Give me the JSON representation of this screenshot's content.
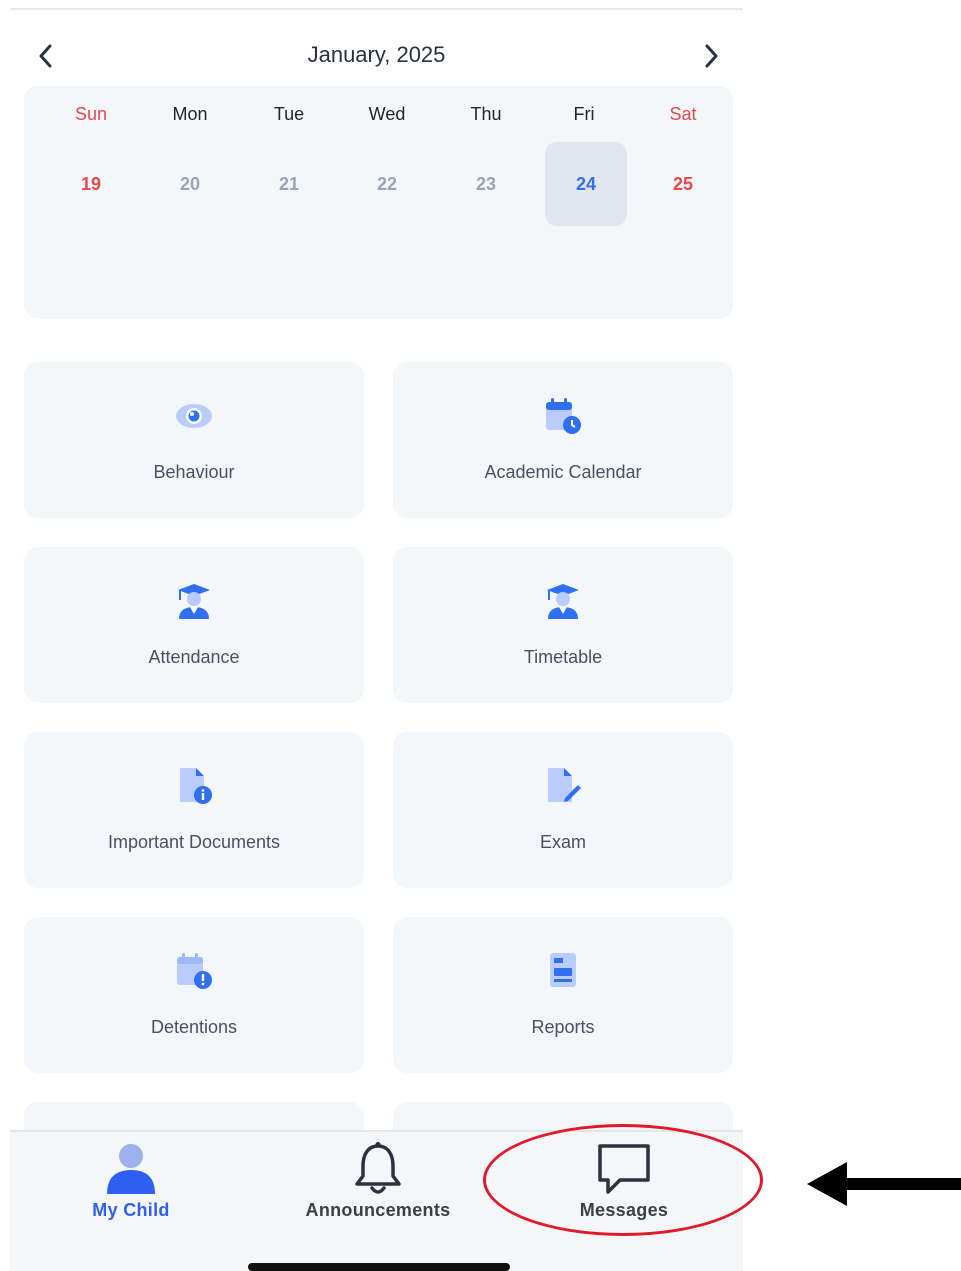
{
  "calendar": {
    "month_title": "January, 2025",
    "days": [
      "Sun",
      "Mon",
      "Tue",
      "Wed",
      "Thu",
      "Fri",
      "Sat"
    ],
    "dates": [
      "19",
      "20",
      "21",
      "22",
      "23",
      "24",
      "25"
    ],
    "selected_date": "24",
    "prev_icon": "chevron-left-icon",
    "next_icon": "chevron-right-icon"
  },
  "tiles": [
    {
      "label": "Behaviour",
      "icon": "eye-icon"
    },
    {
      "label": "Academic Calendar",
      "icon": "calendar-clock-icon"
    },
    {
      "label": "Attendance",
      "icon": "graduate-icon"
    },
    {
      "label": "Timetable",
      "icon": "graduate-icon"
    },
    {
      "label": "Important Documents",
      "icon": "document-info-icon"
    },
    {
      "label": "Exam",
      "icon": "document-edit-icon"
    },
    {
      "label": "Detentions",
      "icon": "calendar-alert-icon"
    },
    {
      "label": "Reports",
      "icon": "report-icon"
    }
  ],
  "bottom_nav": {
    "tabs": [
      {
        "label": "My Child",
        "icon": "person-icon",
        "active": true
      },
      {
        "label": "Announcements",
        "icon": "bell-icon",
        "active": false
      },
      {
        "label": "Messages",
        "icon": "chat-bubble-icon",
        "active": false
      }
    ]
  },
  "colors": {
    "accent": "#2f6ff0",
    "weekend": "#e5484d",
    "tile_bg": "#f3f7f9",
    "highlight_ellipse": "#e0192b"
  },
  "annotations": {
    "highlight": "red-ellipse around Messages",
    "pointer": "black arrow pointing left"
  }
}
